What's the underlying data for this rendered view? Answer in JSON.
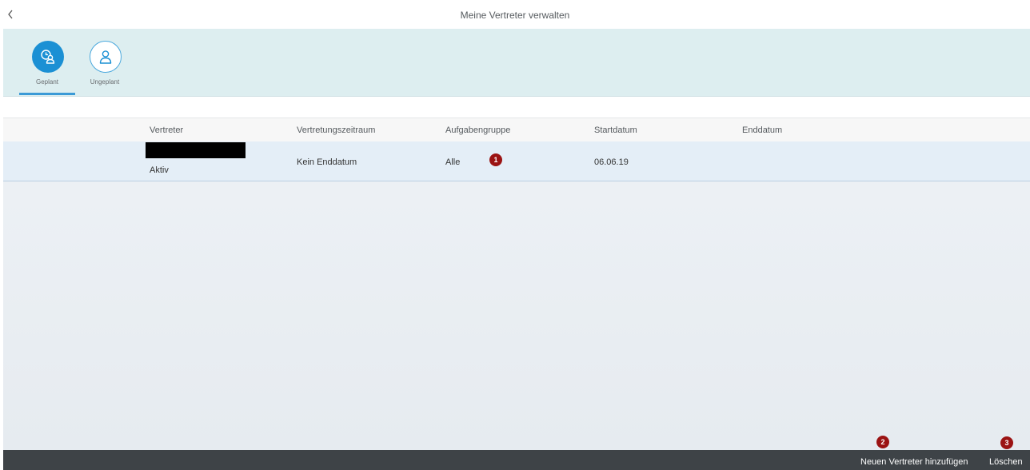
{
  "header": {
    "back_icon": "chevron-left-icon",
    "title": "Meine Vertreter verwalten"
  },
  "tabs": [
    {
      "label": "Geplant",
      "icon": "calendar-person-icon",
      "selected": true
    },
    {
      "label": "Ungeplant",
      "icon": "person-icon",
      "selected": false
    }
  ],
  "table": {
    "columns": [
      "Vertreter",
      "Vertretungszeitraum",
      "Aufgabengruppe",
      "Startdatum",
      "Enddatum"
    ],
    "rows": [
      {
        "vertreter_status": "Aktiv",
        "zeitraum": "Kein Enddatum",
        "aufgabengruppe": "Alle",
        "startdatum": "06.06.19",
        "enddatum": ""
      }
    ]
  },
  "markers": [
    "1",
    "2",
    "3"
  ],
  "footer": {
    "add_label": "Neuen Vertreter hinzufügen",
    "delete_label": "Löschen"
  },
  "colors": {
    "accent": "#1b90d4",
    "marker": "#9b1313",
    "footer_bg": "#3e4347",
    "row_selected": "#e4eef7"
  }
}
